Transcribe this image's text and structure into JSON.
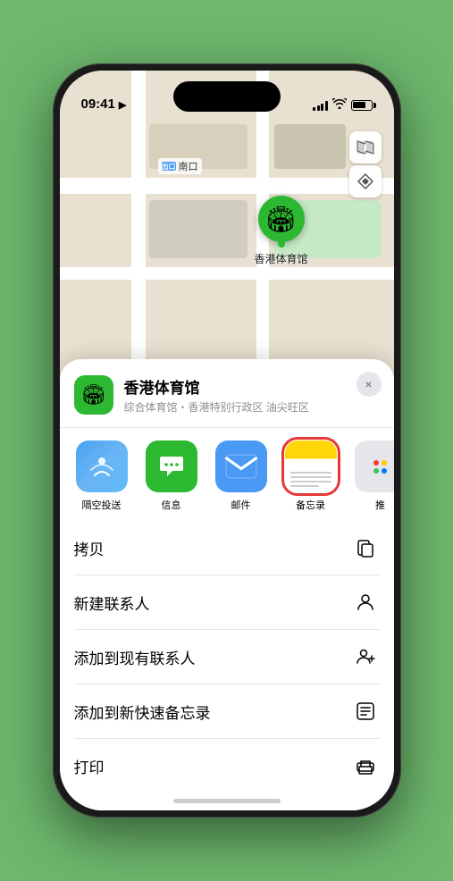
{
  "statusBar": {
    "time": "09:41",
    "locationIcon": "▶"
  },
  "mapLabels": {
    "nankou": "南口",
    "venue": "香港体育馆"
  },
  "mapControls": {
    "mapTypeIcon": "🗺",
    "locationIcon": "⬆"
  },
  "venueCard": {
    "name": "香港体育馆",
    "description": "综合体育馆・香港特别行政区 油尖旺区",
    "closeLabel": "×"
  },
  "shareItems": [
    {
      "label": "隔空投送",
      "type": "airdrop"
    },
    {
      "label": "信息",
      "type": "messages"
    },
    {
      "label": "邮件",
      "type": "mail"
    },
    {
      "label": "备忘录",
      "type": "notes"
    },
    {
      "label": "推",
      "type": "more"
    }
  ],
  "actionItems": [
    {
      "label": "拷贝",
      "iconType": "copy"
    },
    {
      "label": "新建联系人",
      "iconType": "person"
    },
    {
      "label": "添加到现有联系人",
      "iconType": "person-add"
    },
    {
      "label": "添加到新快速备忘录",
      "iconType": "note"
    },
    {
      "label": "打印",
      "iconType": "print"
    }
  ]
}
